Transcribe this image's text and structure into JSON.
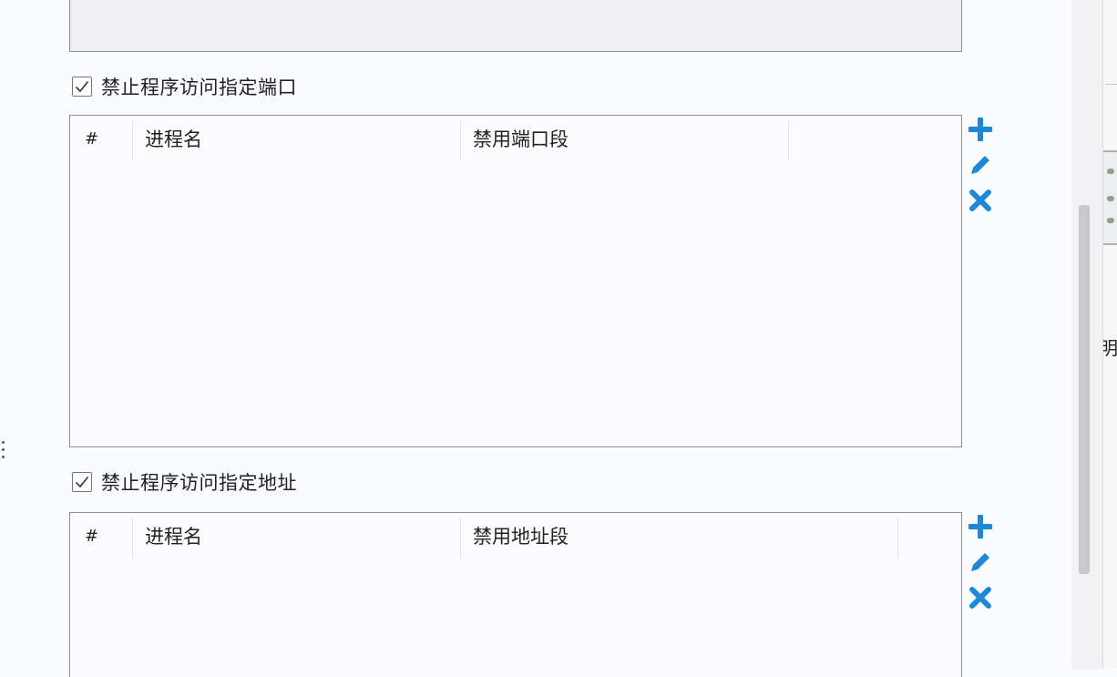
{
  "port_rule": {
    "checked": true,
    "label": "禁止程序访问指定端口",
    "columns": [
      "#",
      "进程名",
      "禁用端口段"
    ],
    "rows": []
  },
  "address_rule": {
    "checked": true,
    "label": "禁止程序访问指定地址",
    "columns": [
      "#",
      "进程名",
      "禁用地址段"
    ],
    "rows": []
  },
  "icons": {
    "add": "plus-icon",
    "edit": "pencil-icon",
    "delete": "close-icon",
    "checkmark": "checkmark-icon"
  },
  "colors": {
    "accent": "#1e88d8",
    "border": "#8d8d95",
    "background": "#fafbfe"
  },
  "right_edge": {
    "clipped_text": "明"
  }
}
